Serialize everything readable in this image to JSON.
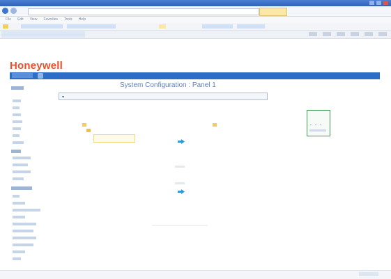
{
  "browser": {
    "title_text": "",
    "address_text": "",
    "menu_items": [
      "File",
      "Edit",
      "View",
      "Favorites",
      "Tools",
      "Help"
    ],
    "page_tab_text": ""
  },
  "app": {
    "logo": "Honeywell",
    "menu_label": "",
    "top_right": ""
  },
  "main": {
    "title": "System Configuration : Panel 1",
    "dropdown_value": "",
    "left_device_label": "",
    "right_device_label": "",
    "panel_title": ""
  },
  "status": {
    "left": "",
    "right": ""
  },
  "colors": {
    "brand": "#e8502a",
    "appbar": "#2d6cc7",
    "arrow": "#2a9ad8",
    "panel_border": "#3d9a56"
  },
  "icons": {
    "arrow": "right-arrow-icon",
    "folder": "folder-icon"
  }
}
